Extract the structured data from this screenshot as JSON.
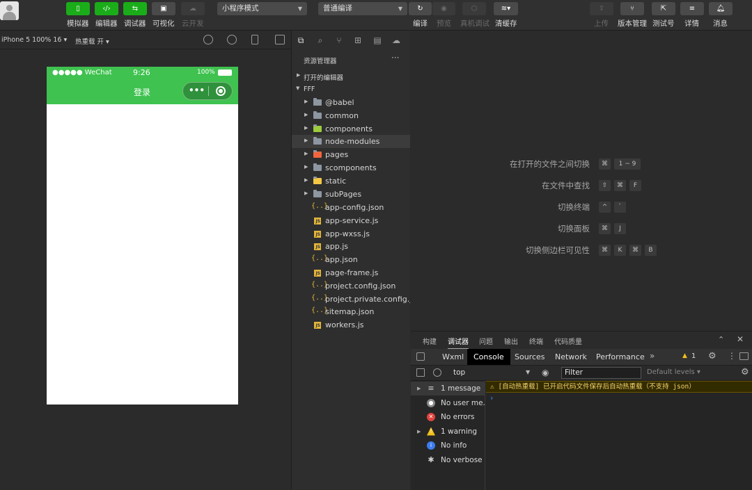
{
  "toolbar": {
    "mode_buttons": [
      {
        "label": "模拟器",
        "icon": "phone-icon"
      },
      {
        "label": "编辑器",
        "icon": "code-icon"
      },
      {
        "label": "调试器",
        "icon": "debug-icon"
      },
      {
        "label": "可视化",
        "icon": "layout-icon"
      },
      {
        "label": "云开发",
        "icon": "cloud-icon"
      }
    ],
    "mode_select": "小程序模式",
    "compile_select": "普通编译",
    "actions": [
      {
        "label": "编译",
        "icon": "refresh-icon"
      },
      {
        "label": "预览",
        "icon": "eye-icon"
      },
      {
        "label": "真机调试",
        "icon": "device-debug-icon"
      },
      {
        "label": "清缓存",
        "icon": "layers-icon"
      }
    ],
    "right_actions": [
      {
        "label": "上传",
        "icon": "upload-icon"
      },
      {
        "label": "版本管理",
        "icon": "branch-icon"
      },
      {
        "label": "测试号",
        "icon": "external-icon"
      },
      {
        "label": "详情",
        "icon": "menu-icon"
      },
      {
        "label": "消息",
        "icon": "bell-icon"
      }
    ]
  },
  "simulator": {
    "device_select": "iPhone 5 100% 16 ▾",
    "hot_reload": "热重载 开 ▾",
    "status_left": "●●●●● WeChat",
    "status_time": "9:26",
    "status_battery": "100%",
    "page_title": "登录",
    "capsule_dots": "•••"
  },
  "explorer": {
    "title": "资源管理器",
    "more": "···",
    "open_editors": "打开的编辑器",
    "project": "FFF",
    "folders": [
      {
        "name": "@babel",
        "color": "#8d96a1"
      },
      {
        "name": "common",
        "color": "#8d96a1"
      },
      {
        "name": "components",
        "color": "#9ccc3d"
      },
      {
        "name": "node-modules",
        "color": "#8d96a1"
      },
      {
        "name": "pages",
        "color": "#f0653f"
      },
      {
        "name": "scomponents",
        "color": "#8d96a1"
      },
      {
        "name": "static",
        "color": "#f3c744"
      },
      {
        "name": "subPages",
        "color": "#8d96a1"
      }
    ],
    "files": [
      {
        "name": "app-config.json",
        "type": "json"
      },
      {
        "name": "app-service.js",
        "type": "js"
      },
      {
        "name": "app-wxss.js",
        "type": "js"
      },
      {
        "name": "app.js",
        "type": "js"
      },
      {
        "name": "app.json",
        "type": "json"
      },
      {
        "name": "page-frame.js",
        "type": "js"
      },
      {
        "name": "project.config.json",
        "type": "json"
      },
      {
        "name": "project.private.config.json",
        "type": "json"
      },
      {
        "name": "sitemap.json",
        "type": "json"
      },
      {
        "name": "workers.js",
        "type": "js"
      }
    ]
  },
  "shortcuts": [
    {
      "label": "在打开的文件之间切换",
      "keys": [
        "⌘",
        "1 ~ 9"
      ]
    },
    {
      "label": "在文件中查找",
      "keys": [
        "⇧",
        "⌘",
        "F"
      ]
    },
    {
      "label": "切换终端",
      "keys": [
        "^",
        "`"
      ]
    },
    {
      "label": "切换面板",
      "keys": [
        "⌘",
        "J"
      ]
    },
    {
      "label": "切换侧边栏可见性",
      "keys": [
        "⌘",
        "K",
        "⌘",
        "B"
      ]
    }
  ],
  "debug": {
    "panel_tabs": [
      "构建",
      "调试器",
      "问题",
      "输出",
      "终端",
      "代码质量"
    ],
    "active_panel_tab": "调试器",
    "dev_tabs": [
      "Wxml",
      "Console",
      "Sources",
      "Network",
      "Performance"
    ],
    "active_dev_tab": "Console",
    "more_tabs": "»",
    "warning_count": "1",
    "context": "top",
    "filter_placeholder": "Filter",
    "levels": "Default levels ▾",
    "console_side": [
      {
        "label": "1 message",
        "icon": "list-icon",
        "color": "#8a8a8a",
        "glyph": "≡"
      },
      {
        "label": "No user me...",
        "icon": "user-icon",
        "color": "#8a8a8a",
        "glyph": "●"
      },
      {
        "label": "No errors",
        "icon": "error-icon",
        "color": "#e0443e",
        "glyph": "✕"
      },
      {
        "label": "1 warning",
        "icon": "warning-icon",
        "color": "#f2c01d",
        "glyph": "!"
      },
      {
        "label": "No info",
        "icon": "info-icon",
        "color": "#3d7cf0",
        "glyph": "i"
      },
      {
        "label": "No verbose",
        "icon": "bug-icon",
        "color": "#8a8a8a",
        "glyph": "✱"
      }
    ],
    "warning_message": "⚠ [自动热重载] 已开启代码文件保存后自动热重载（不支持 json）",
    "prompt": "›"
  },
  "colors": {
    "accent_green": "#1aad19",
    "nav_green": "#3fc24f",
    "warning": "#f5d36c"
  }
}
